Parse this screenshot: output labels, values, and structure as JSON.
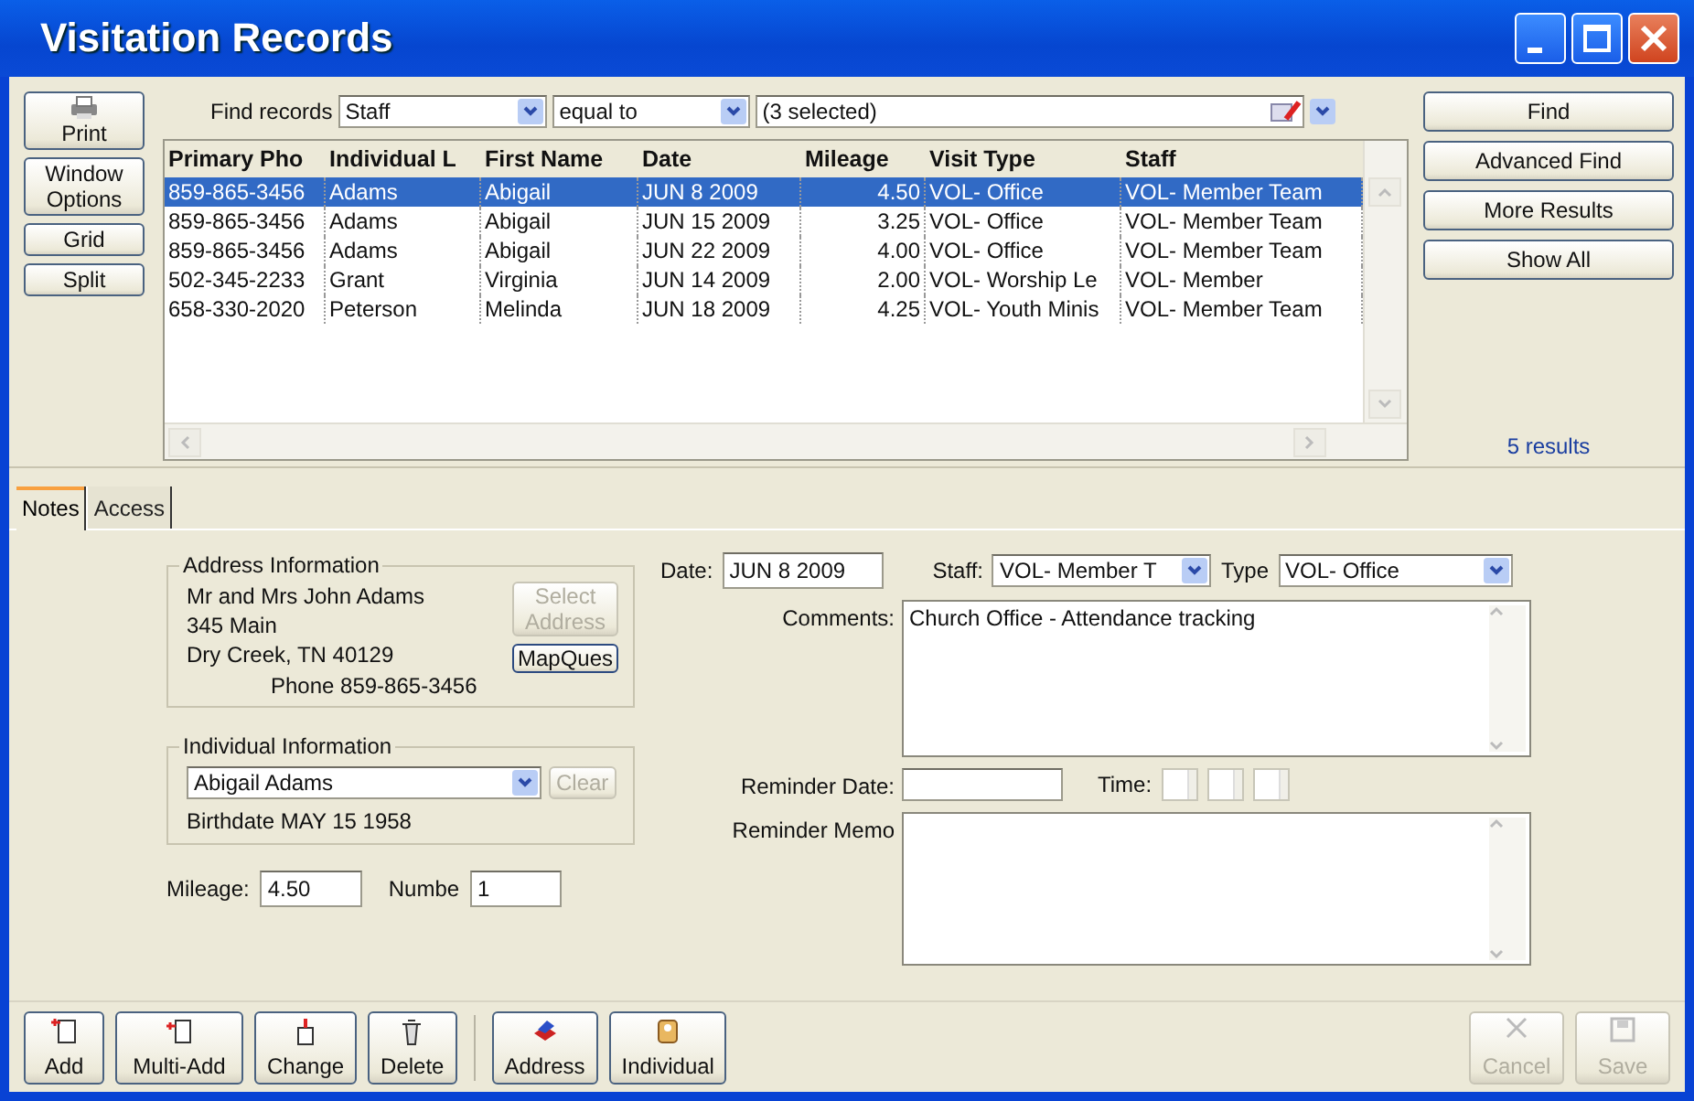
{
  "window": {
    "title": "Visitation Records"
  },
  "side_buttons": [
    {
      "label": "Print",
      "kind": "icon"
    },
    {
      "label": "Window Options",
      "kind": "text"
    },
    {
      "label": "Grid",
      "kind": "text"
    },
    {
      "label": "Split",
      "kind": "text"
    }
  ],
  "find": {
    "label": "Find records",
    "field": "Staff",
    "operator": "equal to",
    "value": "(3 selected)"
  },
  "find_buttons": [
    "Find",
    "Advanced Find",
    "More Results",
    "Show All"
  ],
  "results_count": "5 results",
  "table": {
    "columns": [
      "Primary Pho",
      "Individual L",
      "First Name",
      "Date",
      "Mileage",
      "Visit Type",
      "Staff"
    ],
    "rows": [
      {
        "cells": [
          "859-865-3456",
          "Adams",
          "Abigail",
          "JUN 8 2009",
          "4.50",
          "VOL- Office",
          "VOL- Member Team"
        ],
        "selected": true
      },
      {
        "cells": [
          "859-865-3456",
          "Adams",
          "Abigail",
          "JUN 15 2009",
          "3.25",
          "VOL- Office",
          "VOL- Member Team"
        ],
        "selected": false
      },
      {
        "cells": [
          "859-865-3456",
          "Adams",
          "Abigail",
          "JUN 22 2009",
          "4.00",
          "VOL- Office",
          "VOL- Member Team"
        ],
        "selected": false
      },
      {
        "cells": [
          "502-345-2233",
          "Grant",
          "Virginia",
          "JUN 14 2009",
          "2.00",
          "VOL- Worship Le",
          "VOL- Member"
        ],
        "selected": false
      },
      {
        "cells": [
          "658-330-2020",
          "Peterson",
          "Melinda",
          "JUN 18 2009",
          "4.25",
          "VOL- Youth Minis",
          "VOL- Member Team"
        ],
        "selected": false
      }
    ]
  },
  "tabs": [
    {
      "label": "Notes",
      "selected": true
    },
    {
      "label": "Access",
      "selected": false
    }
  ],
  "address": {
    "title": "Address Information",
    "lines": [
      "Mr and Mrs John Adams",
      "345 Main",
      "Dry Creek, TN  40129"
    ],
    "select_button": {
      "label": "Select Address",
      "disabled": true
    },
    "map_button": {
      "label": "MapQues",
      "disabled": false
    },
    "phone": "Phone  859-865-3456"
  },
  "individual": {
    "title": "Individual Information",
    "name": "Abigail Adams",
    "clear_button": {
      "label": "Clear",
      "disabled": true
    },
    "birthdate": "Birthdate  MAY 15 1958"
  },
  "mileage": {
    "label": "Mileage:",
    "value": "4.50"
  },
  "number": {
    "label": "Numbe",
    "value": "1"
  },
  "date": {
    "label": "Date:",
    "value": "JUN 8 2009"
  },
  "staff": {
    "label": "Staff:",
    "value": "VOL- Member T"
  },
  "type": {
    "label": "Type",
    "value": "VOL- Office"
  },
  "comments": {
    "label": "Comments:",
    "value": "Church Office - Attendance tracking"
  },
  "reminder_date": {
    "label": "Reminder Date:"
  },
  "time": {
    "label": "Time:"
  },
  "reminder_memo": {
    "label": "Reminder Memo"
  },
  "toolbar": [
    {
      "label": "Add",
      "disabled": false
    },
    {
      "label": "Multi-Add",
      "disabled": false
    },
    {
      "label": "Change",
      "disabled": false
    },
    {
      "label": "Delete",
      "disabled": false
    },
    {
      "label": "Address",
      "disabled": false
    },
    {
      "label": "Individual",
      "disabled": false
    }
  ],
  "toolbar_right": [
    {
      "label": "Cancel",
      "disabled": true
    },
    {
      "label": "Save",
      "disabled": true
    }
  ]
}
